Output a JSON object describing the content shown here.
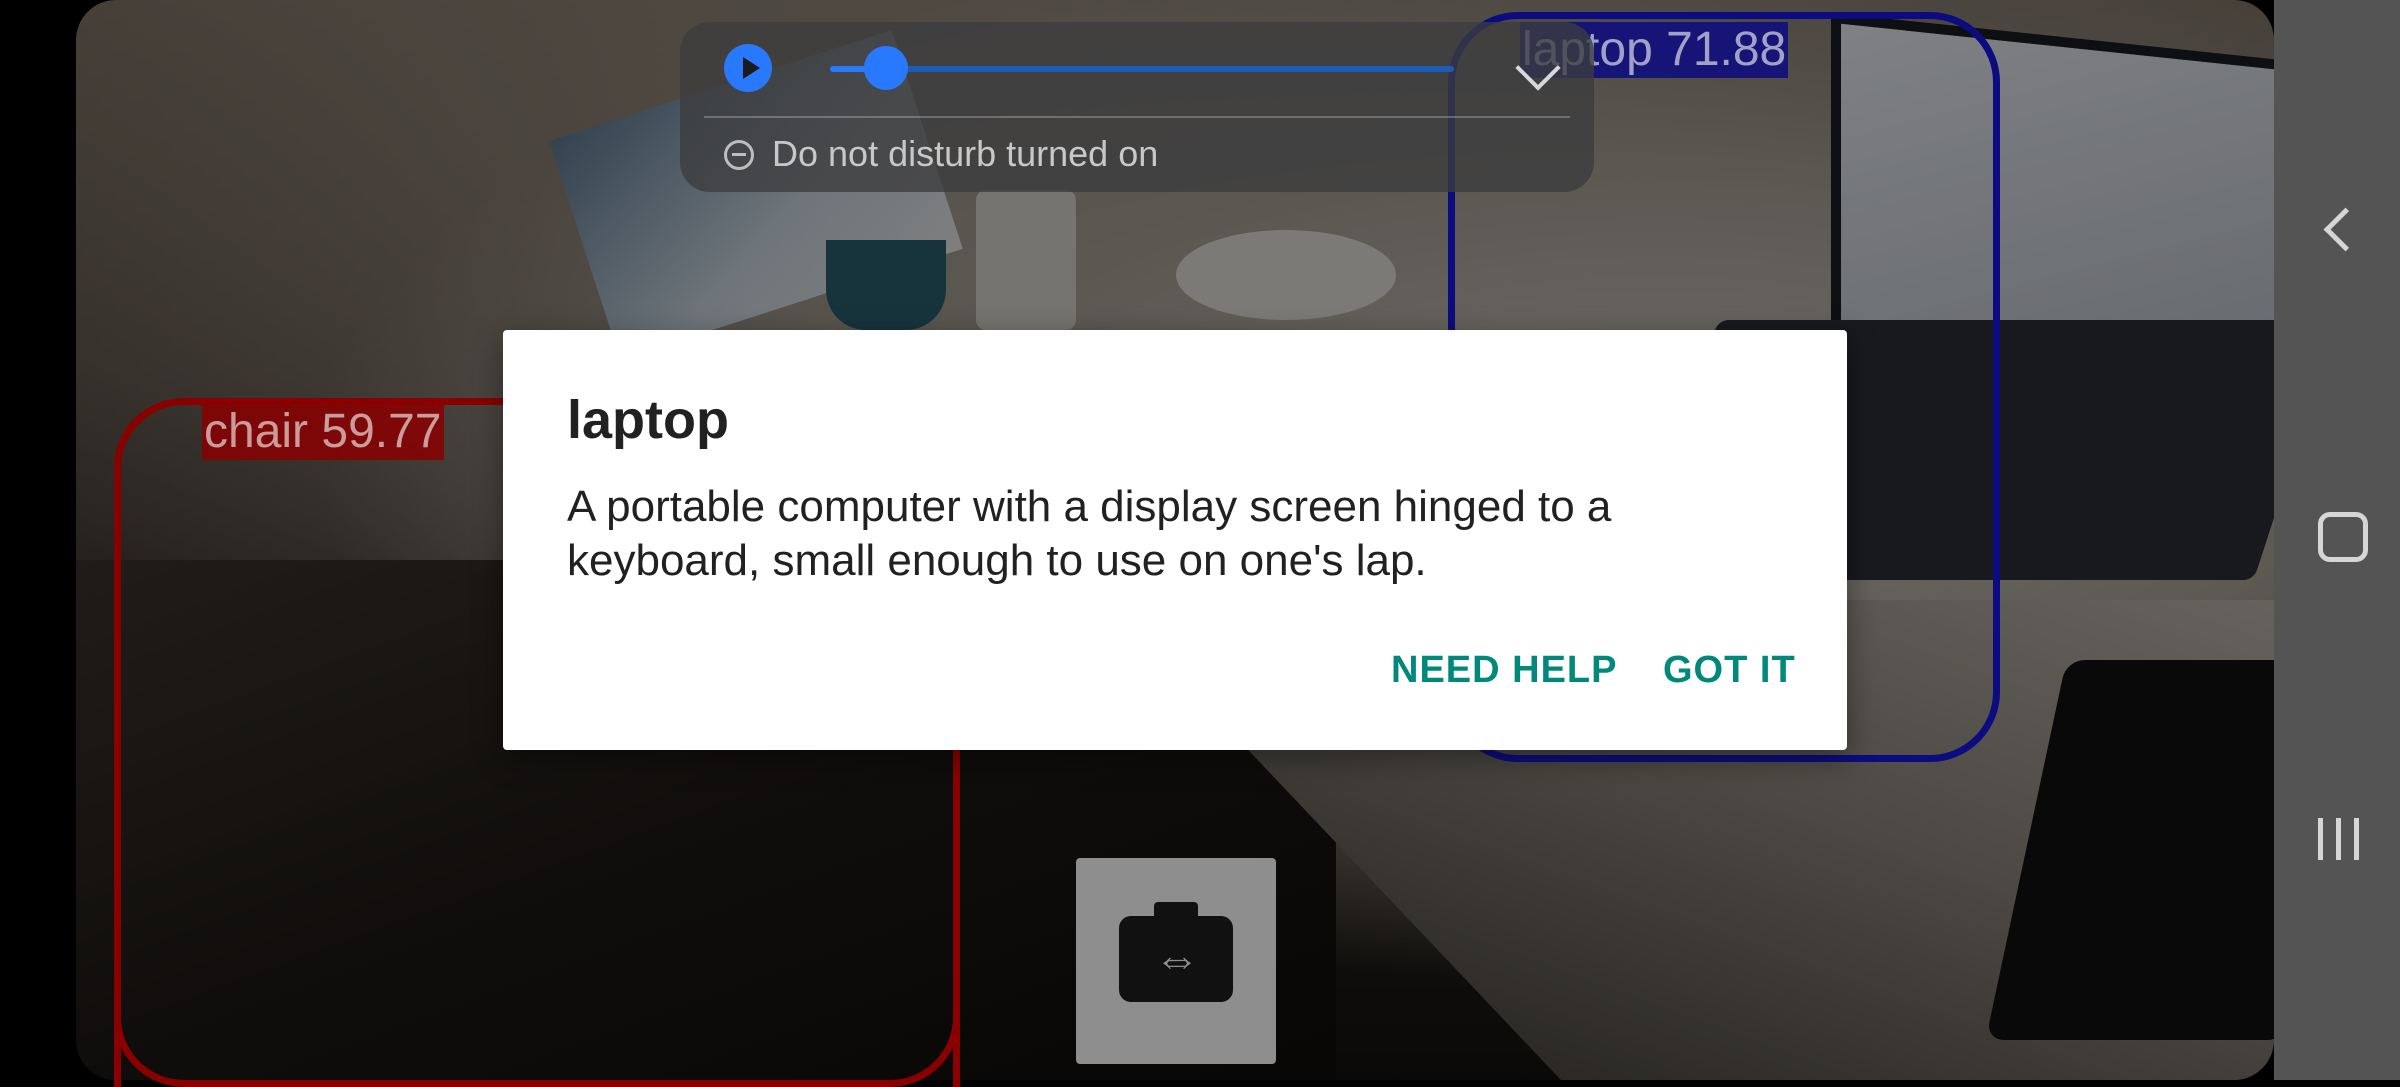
{
  "detections": [
    {
      "label": "chair 59.77",
      "color": "#8a0000"
    },
    {
      "label": "laptop 71.88",
      "color": "#0c0c80"
    }
  ],
  "media": {
    "playback_progress": 0.09,
    "dnd_text": "Do not disturb turned on",
    "accent": "#2979ff"
  },
  "dialog": {
    "title": "laptop",
    "body": "A portable computer with a display screen hinged to a keyboard, small enough to use on one's lap.",
    "need_help_label": "NEED HELP",
    "got_it_label": "GOT IT",
    "button_color": "#00897b"
  },
  "icons": {
    "switch_camera": "switch-camera-icon",
    "play": "play-icon",
    "expand": "chevron-down-icon",
    "dnd": "do-not-disturb-icon",
    "back": "back-icon",
    "home": "home-icon",
    "recents": "recents-icon"
  }
}
